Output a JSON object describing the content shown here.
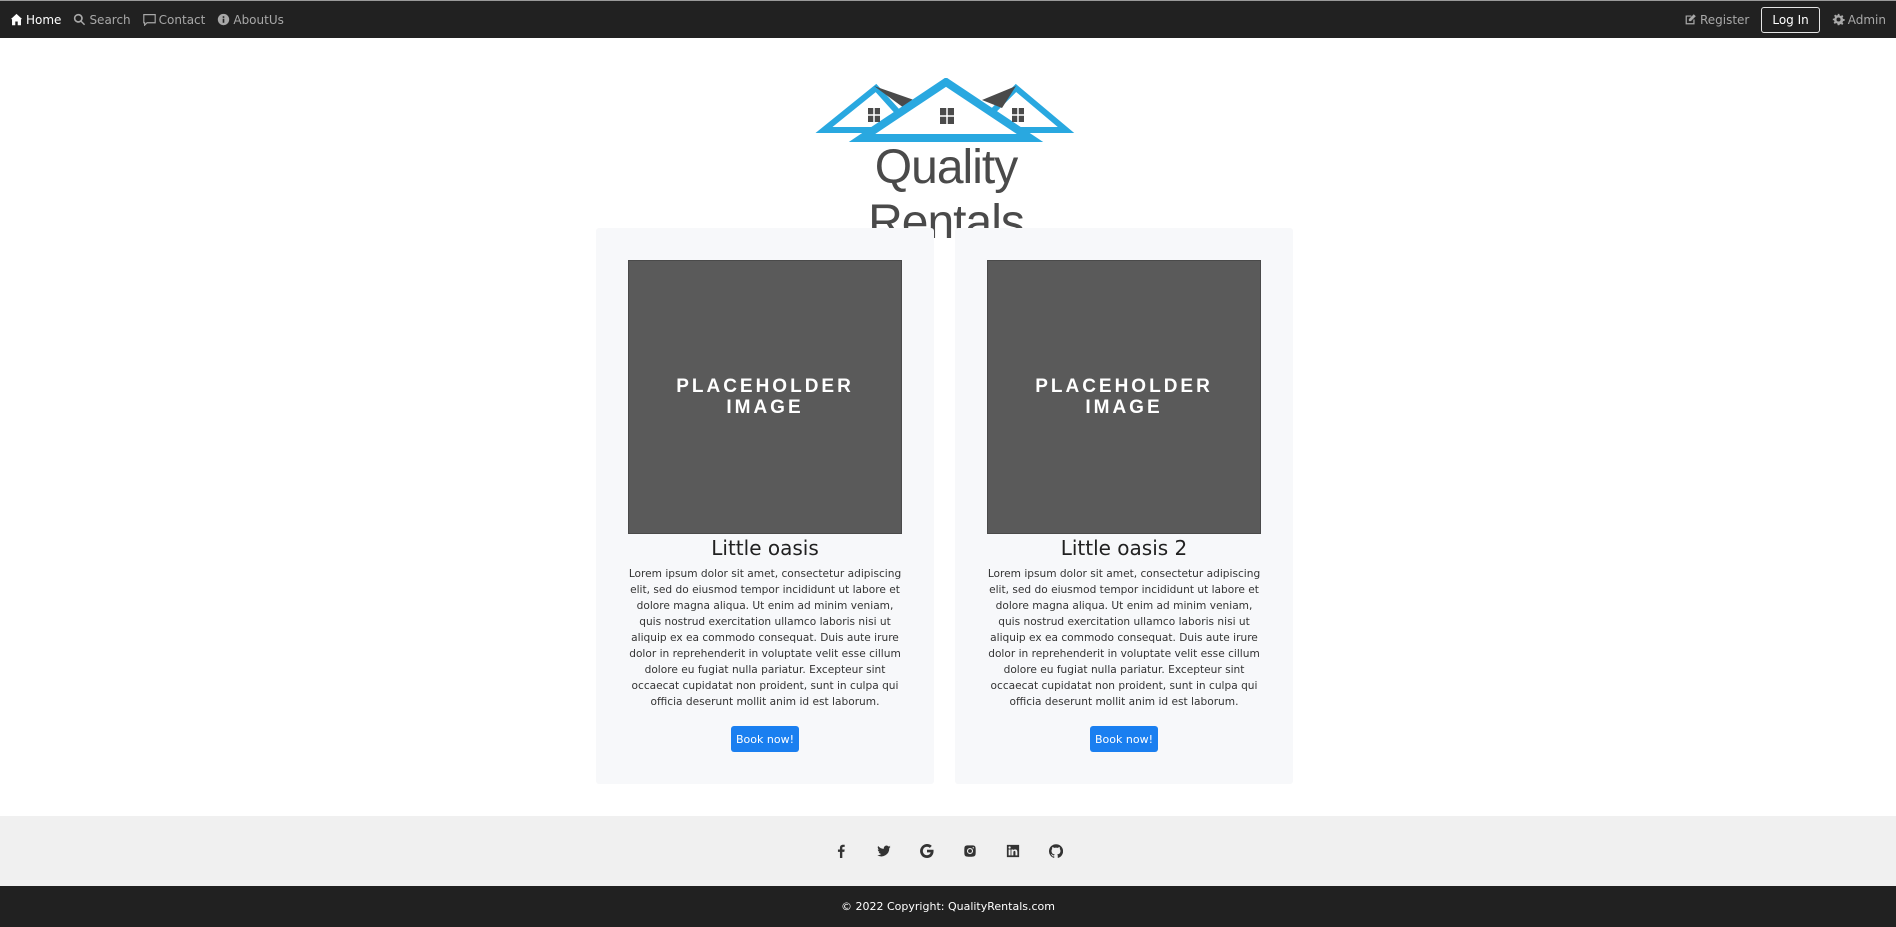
{
  "nav": {
    "home": "Home",
    "search": "Search",
    "contact": "Contact",
    "about": "AboutUs",
    "register": "Register",
    "login": "Log In",
    "admin": "Admin"
  },
  "logo": {
    "text": "Quality Rentals",
    "colors": {
      "roof_blue": "#29a8e0",
      "roof_gray": "#4a4a4a"
    }
  },
  "cards": [
    {
      "image_text": "PLACEHOLDER\nIMAGE",
      "title": "Little oasis",
      "description": "Lorem ipsum dolor sit amet, consectetur adipiscing elit, sed do eiusmod tempor incididunt ut labore et dolore magna aliqua. Ut enim ad minim veniam, quis nostrud exercitation ullamco laboris nisi ut aliquip ex ea commodo consequat. Duis aute irure dolor in reprehenderit in voluptate velit esse cillum dolore eu fugiat nulla pariatur. Excepteur sint occaecat cupidatat non proident, sunt in culpa qui officia deserunt mollit anim id est laborum.",
      "button": "Book now!"
    },
    {
      "image_text": "PLACEHOLDER\nIMAGE",
      "title": "Little oasis 2",
      "description": "Lorem ipsum dolor sit amet, consectetur adipiscing elit, sed do eiusmod tempor incididunt ut labore et dolore magna aliqua. Ut enim ad minim veniam, quis nostrud exercitation ullamco laboris nisi ut aliquip ex ea commodo consequat. Duis aute irure dolor in reprehenderit in voluptate velit esse cillum dolore eu fugiat nulla pariatur. Excepteur sint occaecat cupidatat non proident, sunt in culpa qui officia deserunt mollit anim id est laborum.",
      "button": "Book now!"
    }
  ],
  "social_icons": [
    "facebook-icon",
    "twitter-icon",
    "google-icon",
    "instagram-icon",
    "linkedin-icon",
    "github-icon"
  ],
  "footer": {
    "copyright": "© 2022 Copyright: QualityRentals.com"
  },
  "colors": {
    "navbar_bg": "#212121",
    "button_blue": "#1a7ff0",
    "placeholder_gray": "#5a5a5a",
    "footer_bg": "#f0f0f0"
  }
}
